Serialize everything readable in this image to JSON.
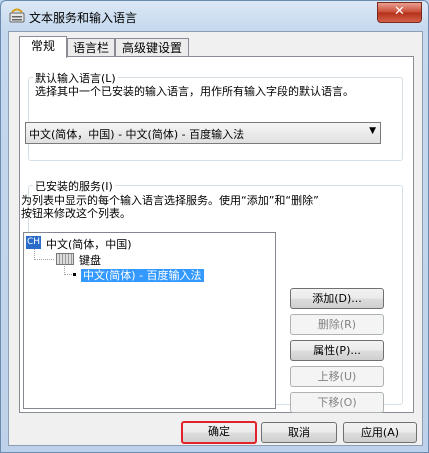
{
  "window": {
    "title": "文本服务和输入语言",
    "close_label": "✕"
  },
  "tabs": [
    {
      "label": "常规",
      "active": true
    },
    {
      "label": "语言栏",
      "active": false
    },
    {
      "label": "高级键设置",
      "active": false
    }
  ],
  "default_language": {
    "group_label": "默认输入语言(L)",
    "description": "选择其中一个已安装的输入语言，用作所有输入字段的默认语言。",
    "selected_value": "中文(简体，中国) - 中文(简体) - 百度输入法"
  },
  "installed_services": {
    "group_label": "已安装的服务(I)",
    "description_line1": "为列表中显示的每个输入语言选择服务。使用“添加”和“删除”",
    "description_line2": "按钮来修改这个列表。",
    "tree": {
      "language": {
        "badge": "CH",
        "label": "中文(简体，中国)"
      },
      "category": {
        "label": "键盘"
      },
      "service": {
        "label": "中文(简体) - 百度输入法",
        "selected": true
      }
    },
    "buttons": {
      "add": "添加(D)...",
      "remove": "删除(R)",
      "properties": "属性(P)...",
      "move_up": "上移(U)",
      "move_down": "下移(O)"
    }
  },
  "footer": {
    "ok": "确定",
    "cancel": "取消",
    "apply": "应用(A)"
  },
  "colors": {
    "selection": "#3399ff",
    "default_button_highlight": "#e0242a"
  }
}
